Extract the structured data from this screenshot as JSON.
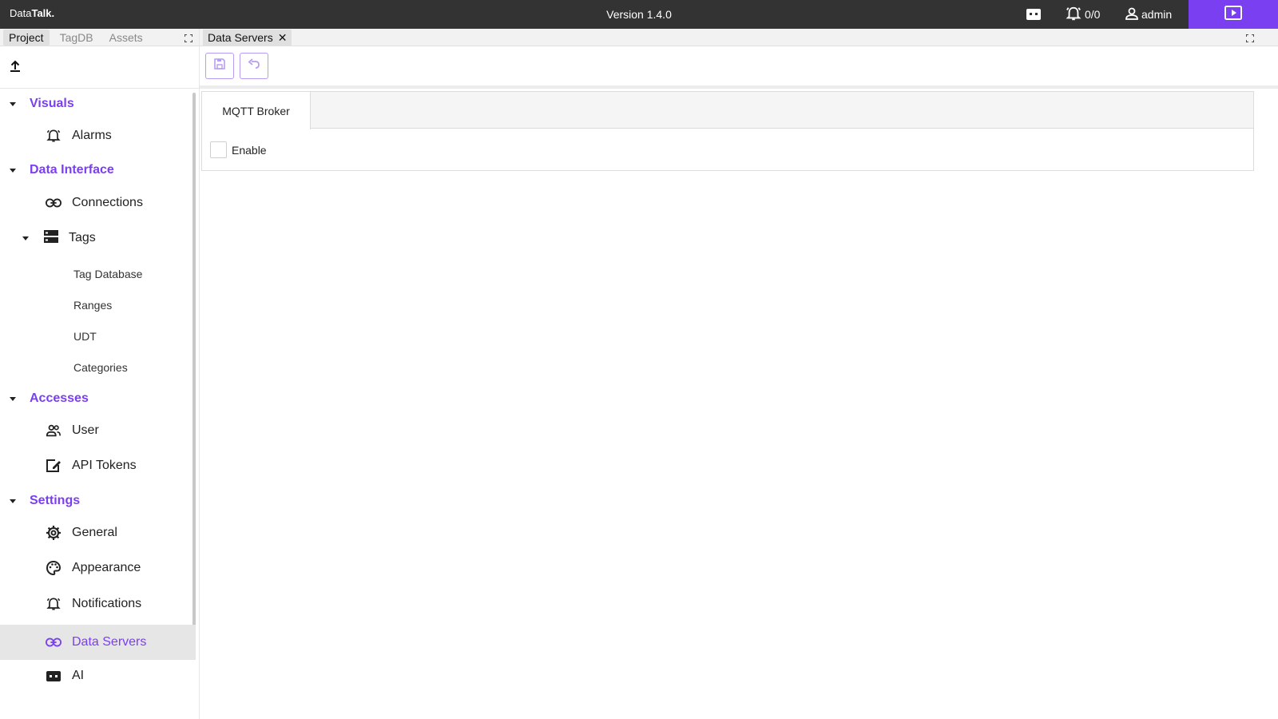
{
  "topbar": {
    "brand_prefix": "Data",
    "brand_suffix": "Talk.",
    "version": "Version 1.4.0",
    "alarm_count": "0/0",
    "user": "admin",
    "accent": "#7b3ff2"
  },
  "left_panel": {
    "tabs": [
      "Project",
      "TagDB",
      "Assets"
    ],
    "active_tab": "Project"
  },
  "nav": {
    "visuals": {
      "label": "Visuals",
      "items": {
        "alarms": "Alarms"
      }
    },
    "data_interface": {
      "label": "Data Interface",
      "items": {
        "connections": "Connections",
        "tags": "Tags",
        "tag_sub": [
          "Tag Database",
          "Ranges",
          "UDT",
          "Categories"
        ]
      }
    },
    "accesses": {
      "label": "Accesses",
      "items": {
        "user": "User",
        "api_tokens": "API Tokens"
      }
    },
    "settings": {
      "label": "Settings",
      "items": {
        "general": "General",
        "appearance": "Appearance",
        "notifications": "Notifications",
        "data_servers": "Data Servers",
        "ai": "AI"
      }
    },
    "active_item": "Data Servers"
  },
  "editor": {
    "open_tab": "Data Servers",
    "panel_tabs": [
      "MQTT Broker"
    ],
    "enable_label": "Enable",
    "enable_checked": false
  }
}
